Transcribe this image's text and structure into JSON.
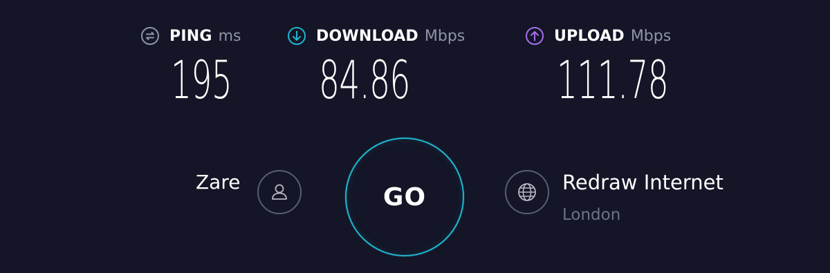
{
  "metrics": {
    "ping": {
      "label": "PING",
      "unit": "ms",
      "value": "195",
      "icon": "ping-icon"
    },
    "download": {
      "label": "DOWNLOAD",
      "unit": "Mbps",
      "value": "84.86",
      "icon": "download-arrow-icon"
    },
    "upload": {
      "label": "UPLOAD",
      "unit": "Mbps",
      "value": "111.78",
      "icon": "upload-arrow-icon"
    }
  },
  "user": {
    "name": "Zare",
    "icon": "user-icon"
  },
  "go_button": {
    "label": "GO"
  },
  "server": {
    "isp": "Redraw Internet",
    "location": "London",
    "icon": "globe-icon"
  },
  "colors": {
    "background": "#141526",
    "download_accent": "#1fb6cf",
    "upload_accent": "#a66ff0",
    "muted_text": "#9193a8",
    "go_ring": "#1fb6cf"
  }
}
